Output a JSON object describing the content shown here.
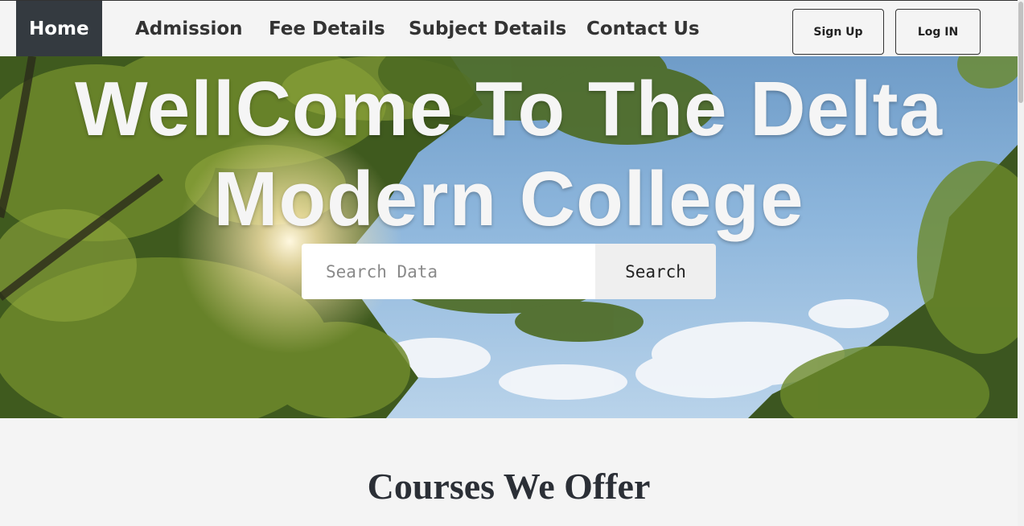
{
  "nav": {
    "items": [
      {
        "label": "Home",
        "active": true
      },
      {
        "label": "Admission"
      },
      {
        "label": "Fee Details"
      },
      {
        "label": "Subject Details"
      },
      {
        "label": "Contact Us"
      }
    ],
    "signup_label": "Sign Up",
    "login_label": "Log IN"
  },
  "hero": {
    "title_line1": "WellCome To The Delta",
    "title_line2": "Modern College",
    "search_placeholder": "Search Data",
    "search_button": "Search"
  },
  "courses": {
    "title": "Courses We Offer"
  },
  "colors": {
    "nav_active_bg": "#343a40",
    "page_bg": "#f4f4f4",
    "text_dark": "#2b2f36"
  }
}
